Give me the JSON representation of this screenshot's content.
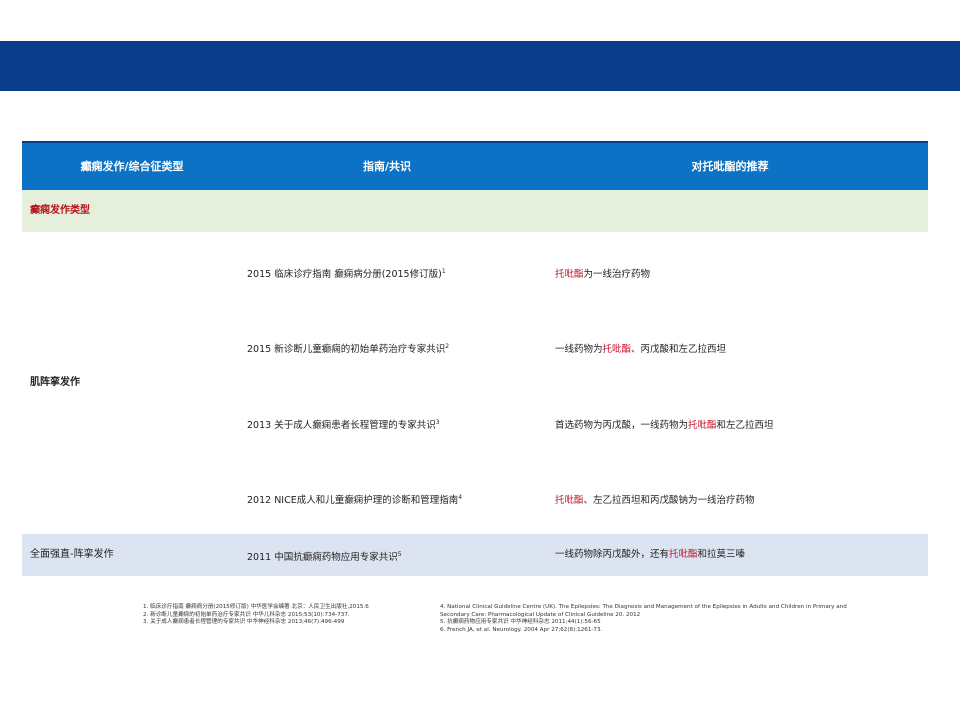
{
  "colors": {
    "top_band": "#0a3c8c",
    "header": "#0c72c6",
    "section_bg": "#e6eedc",
    "last_row_bg": "#dde4f1",
    "accent_red": "#c8102e"
  },
  "table": {
    "headers": [
      "癫痫发作/综合征类型",
      "指南/共识",
      "对托吡酯的推荐"
    ],
    "section_label": "癫痫发作类型",
    "group": {
      "seizure_type": "肌阵挛发作",
      "rows": [
        {
          "guideline": "2015 临床诊疗指南 癫痫病分册(2015修订版)",
          "sup": "1",
          "rec_pre": "",
          "rec_red": "托吡酯",
          "rec_post": "为一线治疗药物"
        },
        {
          "guideline": "2015 新诊断儿童癫痫的初始单药治疗专家共识",
          "sup": "2",
          "rec_pre": "一线药物为",
          "rec_red": "托吡酯",
          "rec_post": "、丙戊酸和左乙拉西坦"
        },
        {
          "guideline": "2013 关于成人癫痫患者长程管理的专家共识",
          "sup": "3",
          "rec_pre": "首选药物为丙戊酸，一线药物为",
          "rec_red": "托吡酯",
          "rec_post": "和左乙拉西坦"
        },
        {
          "guideline": "2012 NICE成人和儿童癫痫护理的诊断和管理指南",
          "sup": "4",
          "rec_pre": "",
          "rec_red": "托吡酯",
          "rec_post": "、左乙拉西坦和丙戊酸钠为一线治疗药物"
        }
      ]
    },
    "last_row": {
      "seizure_type": "全面强直-阵挛发作",
      "guideline": "2011 中国抗癫痫药物应用专家共识",
      "sup": "5",
      "rec_pre": "一线药物除丙戊酸外，还有",
      "rec_red": "托吡酯",
      "rec_post": "和拉莫三嗪"
    }
  },
  "references": {
    "left": [
      "1. 临床诊疗指南 癫痫病分册(2015修订版) 中华医学会编著 北京：人民卫生出版社,2015.6",
      "2. 新诊断儿童癫痫的初始单药治疗专家共识 中华儿科杂志 2015;53(10):734-737.",
      "3. 关于成人癫痫患者长程管理的专家共识 中华神经科杂志 2013;46(7):496-499"
    ],
    "right": [
      "4. National Clinical Guideline Centre (UK). The Epilepsies: The Diagnosis and Management of the Epilepsies in Adults and Children in Primary and",
      "Secondary Care: Pharmacological Update of Clinical Guideline 20. 2012",
      "5. 抗癫痫药物应用专家共识 中华神经科杂志 2011;44(1):56-65",
      "6. French JA, et al. Neurology. 2004 Apr 27;62(8):1261-73."
    ]
  }
}
